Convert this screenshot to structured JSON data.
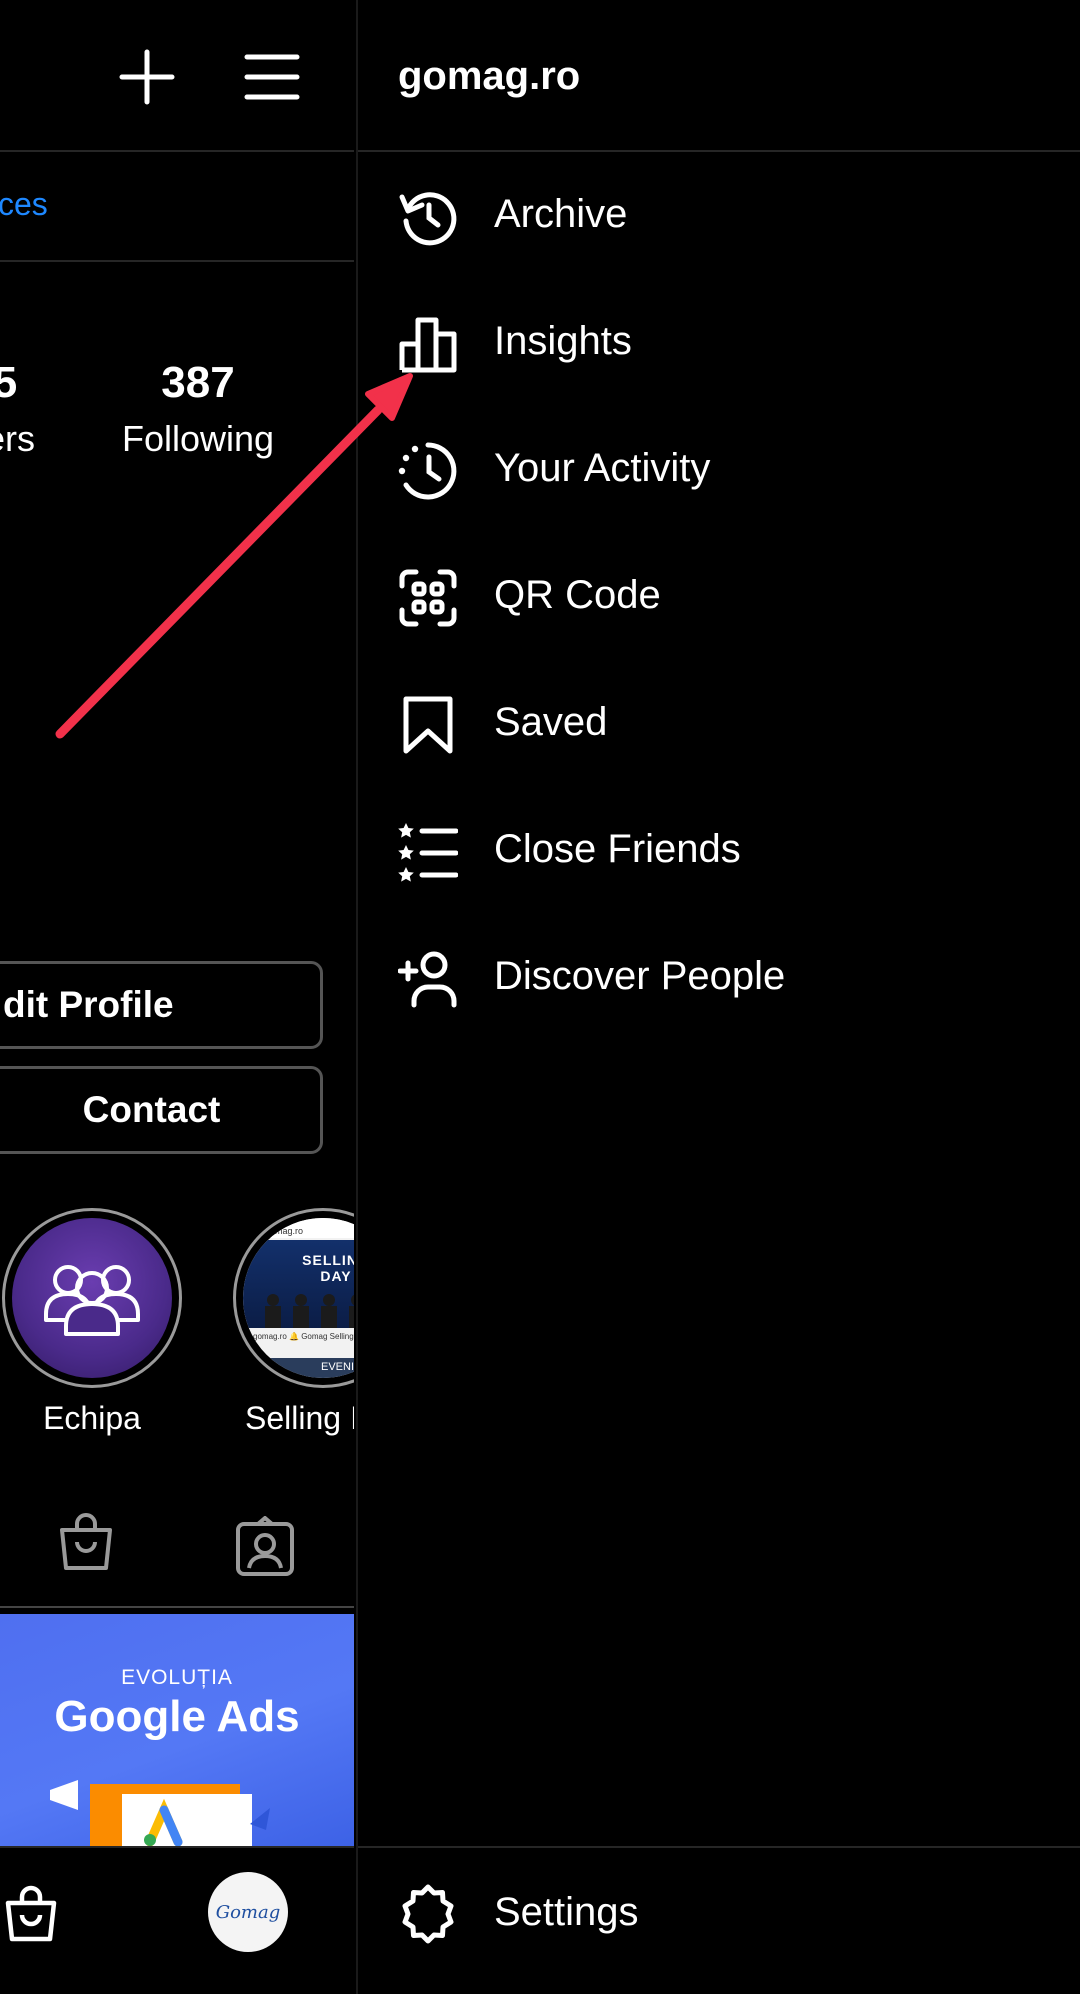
{
  "left_panel": {
    "header_link_partial": "ces",
    "stats": [
      {
        "value": "5",
        "label": "ers"
      },
      {
        "value": "387",
        "label": "Following"
      }
    ],
    "buttons": {
      "edit_profile": "dit Profile",
      "contact": "Contact"
    },
    "highlights": [
      {
        "label": "Echipa"
      },
      {
        "label": "Selling I",
        "thumb_top": "gomag.ro",
        "thumb_title": "SELLING DAY",
        "thumb_caption": "gomag.ro 🔔 Gomag Selling Day!",
        "thumb_badge": "EVENIMENT"
      }
    ],
    "post": {
      "kicker": "EVOLUȚIA",
      "title": "Google Ads"
    },
    "bottom_nav_avatar": "Gomag"
  },
  "drawer": {
    "title": "gomag.ro",
    "items": [
      {
        "label": "Archive",
        "icon": "archive-icon"
      },
      {
        "label": "Insights",
        "icon": "insights-icon"
      },
      {
        "label": "Your Activity",
        "icon": "activity-icon"
      },
      {
        "label": "QR Code",
        "icon": "qr-code-icon"
      },
      {
        "label": "Saved",
        "icon": "bookmark-icon"
      },
      {
        "label": "Close Friends",
        "icon": "close-friends-icon"
      },
      {
        "label": "Discover People",
        "icon": "add-person-icon"
      }
    ],
    "settings": {
      "label": "Settings",
      "icon": "gear-icon"
    }
  },
  "colors": {
    "background": "#000000",
    "link": "#1e88ff",
    "annotation_arrow": "#f2314a",
    "post_bg": "#4f6ff0"
  }
}
